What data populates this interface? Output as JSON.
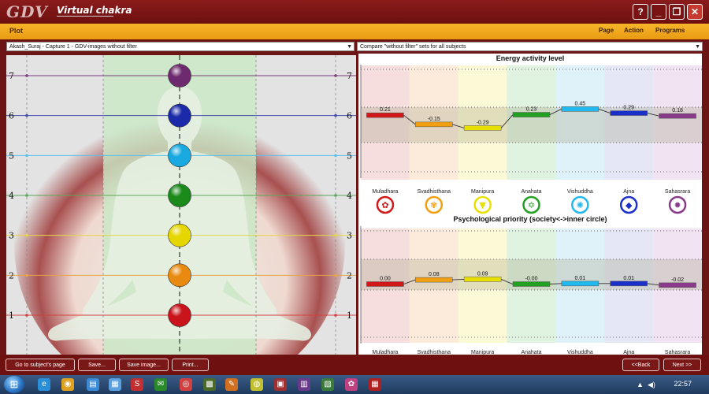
{
  "window": {
    "logo_text": "GDV",
    "title": "Virtual chakra",
    "help_label": "?",
    "minimize_label": "_",
    "restore_label": "❐",
    "close_label": "✕"
  },
  "menubar": {
    "section_title": "Plot",
    "items": [
      "Page",
      "Action",
      "Programs"
    ]
  },
  "selectors": {
    "left_value": "Akash_Suraj - Capture 1 - GDV-images without filter",
    "right_value": "Compare \"without filter\" sets for all subjects"
  },
  "left_panel": {
    "levels": [
      "1",
      "2",
      "3",
      "4",
      "5",
      "6",
      "7"
    ],
    "chakra_colors": [
      "#c8141a",
      "#e88a10",
      "#e6d600",
      "#1a8a1a",
      "#19a9e0",
      "#1a2aa8",
      "#6e2a6e"
    ],
    "line_colors": [
      "#d14040",
      "#e8a24a",
      "#e5d840",
      "#5aa85a",
      "#5ac0e8",
      "#404aa8",
      "#7a3a7a"
    ]
  },
  "right_panel": {
    "chart1_title": "Energy activity level",
    "chart2_title": "Psychological priority (society<->inner circle)",
    "chakra_names": [
      "Muladhara",
      "Svadhisthana",
      "Manipura",
      "Anahata",
      "Vishuddha",
      "Ajna",
      "Sahasrara"
    ],
    "band_colors": [
      "#f4d6d6",
      "#fbe6d2",
      "#fbf7cc",
      "#d8efd8",
      "#d8eff8",
      "#dfe0f4",
      "#efdcef"
    ],
    "bar_colors": [
      "#d01818",
      "#f0a010",
      "#e8e000",
      "#22a022",
      "#22b8f0",
      "#1a30c8",
      "#8a3a8a"
    ],
    "symbol_glyphs": [
      "✿",
      "✾",
      "▼",
      "✡",
      "✺",
      "◆",
      "✹"
    ]
  },
  "chart_data": [
    {
      "type": "line",
      "title": "Energy activity level",
      "categories": [
        "Muladhara",
        "Svadhisthana",
        "Manipura",
        "Anahata",
        "Vishuddha",
        "Ajna",
        "Sahasrara"
      ],
      "values": [
        0.21,
        -0.15,
        -0.29,
        0.23,
        0.45,
        0.29,
        0.18
      ],
      "value_labels": [
        "0.21",
        "-0.15",
        "-0.29",
        "0.23",
        "0.45",
        "0.29",
        "0.18"
      ],
      "ylim": [
        -2.0,
        2.0
      ],
      "grid": true
    },
    {
      "type": "line",
      "title": "Psychological priority (society<->inner circle)",
      "categories": [
        "Muladhara",
        "Svadhisthana",
        "Manipura",
        "Anahata",
        "Vishuddha",
        "Ajna",
        "Sahasrara"
      ],
      "values": [
        0.0,
        0.08,
        0.09,
        -0.0,
        0.01,
        0.01,
        -0.02
      ],
      "value_labels": [
        "0.00",
        "0.08",
        "0.09",
        "-0.00",
        "0.01",
        "0.01",
        "-0.02"
      ],
      "ylim": [
        -1.0,
        1.0
      ],
      "grid": true
    }
  ],
  "bottom_buttons": {
    "subject_page": "Go to subject's page",
    "save": "Save...",
    "save_image": "Save image...",
    "print": "Print...",
    "back": "<<Back",
    "next": "Next >>"
  },
  "taskbar": {
    "start_glyph": "⊞",
    "clock": "22:57",
    "tray_flag": "▲",
    "tray_sound": "◀)",
    "icon_colors": [
      "#2b8fd8",
      "#e0a020",
      "#3a8ad8",
      "#5aa0e0",
      "#c03030",
      "#2a8a2a",
      "#d04040",
      "#4a6a2a",
      "#d07020",
      "#c0c030",
      "#a03030",
      "#6a3a8a",
      "#3a7a3a",
      "#c04080",
      "#b02020"
    ],
    "icon_glyphs": [
      "e",
      "◉",
      "▤",
      "▦",
      "S",
      "✉",
      "◎",
      "▩",
      "✎",
      "◍",
      "▣",
      "▥",
      "▧",
      "✿",
      "▦"
    ]
  }
}
